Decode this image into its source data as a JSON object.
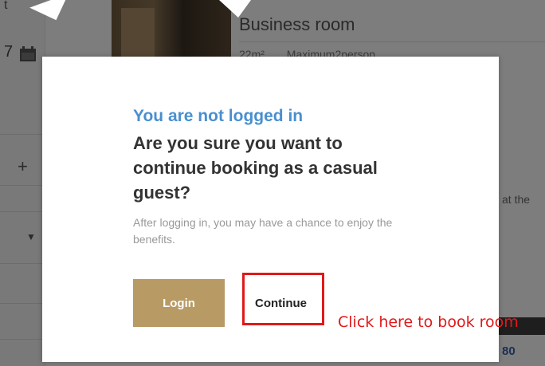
{
  "background": {
    "left_label_top": "t",
    "left_date": "7",
    "plus_symbol": "+",
    "caret_symbol": "▼",
    "room": {
      "title": "Business room",
      "area": "22m²",
      "capacity": "Maximum2person"
    },
    "right_snippet": "at the",
    "price_fragment": "80"
  },
  "modal": {
    "heading": "You are not logged in",
    "question": "Are you sure you want to continue booking as a casual guest?",
    "note": "After logging in, you may have a chance to enjoy the benefits.",
    "login_label": "Login",
    "continue_label": "Continue"
  },
  "annotation": {
    "text": "Click here to book room",
    "color": "#e11919"
  },
  "colors": {
    "heading_blue": "#4a8fcf",
    "login_gold": "#b89a64",
    "overlay": "rgba(0,0,0,0.5)"
  },
  "icons": [
    "calendar-icon"
  ]
}
